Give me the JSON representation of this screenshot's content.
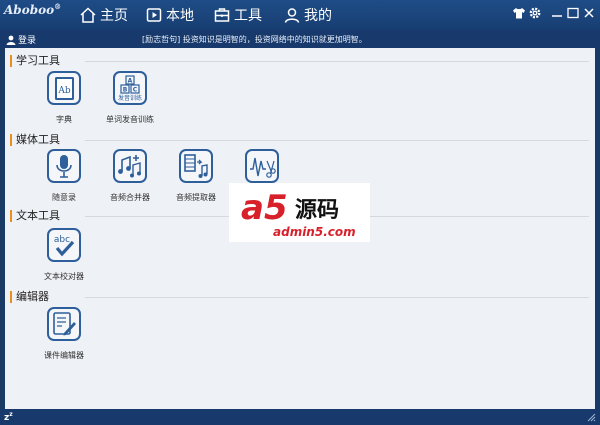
{
  "app": {
    "logo_text": "Aboboo",
    "logo_mark": "®"
  },
  "nav": [
    {
      "label": "主页",
      "icon": "home-icon"
    },
    {
      "label": "本地",
      "icon": "play-icon"
    },
    {
      "label": "工具",
      "icon": "toolbox-icon"
    },
    {
      "label": "我的",
      "icon": "user-icon"
    }
  ],
  "window_controls": [
    "shirt-icon",
    "gear-icon",
    "minimize-icon",
    "maximize-icon",
    "close-icon"
  ],
  "subbar": {
    "login_label": "登录",
    "ticker": "[励志哲句] 投资知识是明智的，投资网络中的知识就更加明智。"
  },
  "sections": [
    {
      "title": "学习工具",
      "tools": [
        {
          "label": "字典",
          "icon": "dictionary-icon",
          "icon_text": "Ab"
        },
        {
          "label": "单词发音训练",
          "icon": "abc-blocks-icon",
          "icon_text": "发音训练"
        }
      ]
    },
    {
      "title": "媒体工具",
      "tools": [
        {
          "label": "随意录",
          "icon": "microphone-icon"
        },
        {
          "label": "音频合并器",
          "icon": "music-merge-icon"
        },
        {
          "label": "音频提取器",
          "icon": "film-music-icon"
        },
        {
          "label": "",
          "icon": "audio-cut-icon"
        }
      ]
    },
    {
      "title": "文本工具",
      "tools": [
        {
          "label": "文本校对器",
          "icon": "abc-check-icon",
          "icon_text": "abc"
        }
      ]
    },
    {
      "title": "编辑器",
      "tools": [
        {
          "label": "课件编辑器",
          "icon": "courseware-edit-icon"
        }
      ]
    }
  ],
  "watermark": {
    "brand": "a5",
    "brand_cn": "源码",
    "url": "admin5.com"
  },
  "statusbar": {
    "sleep_text": "z",
    "sleep_sup": "z"
  },
  "colors": {
    "titlebar": "#1f4c86",
    "accent": "#2e5f9b",
    "section_mark": "#e8901c",
    "content_bg": "#eef1f5",
    "watermark_red": "#d8202a"
  }
}
